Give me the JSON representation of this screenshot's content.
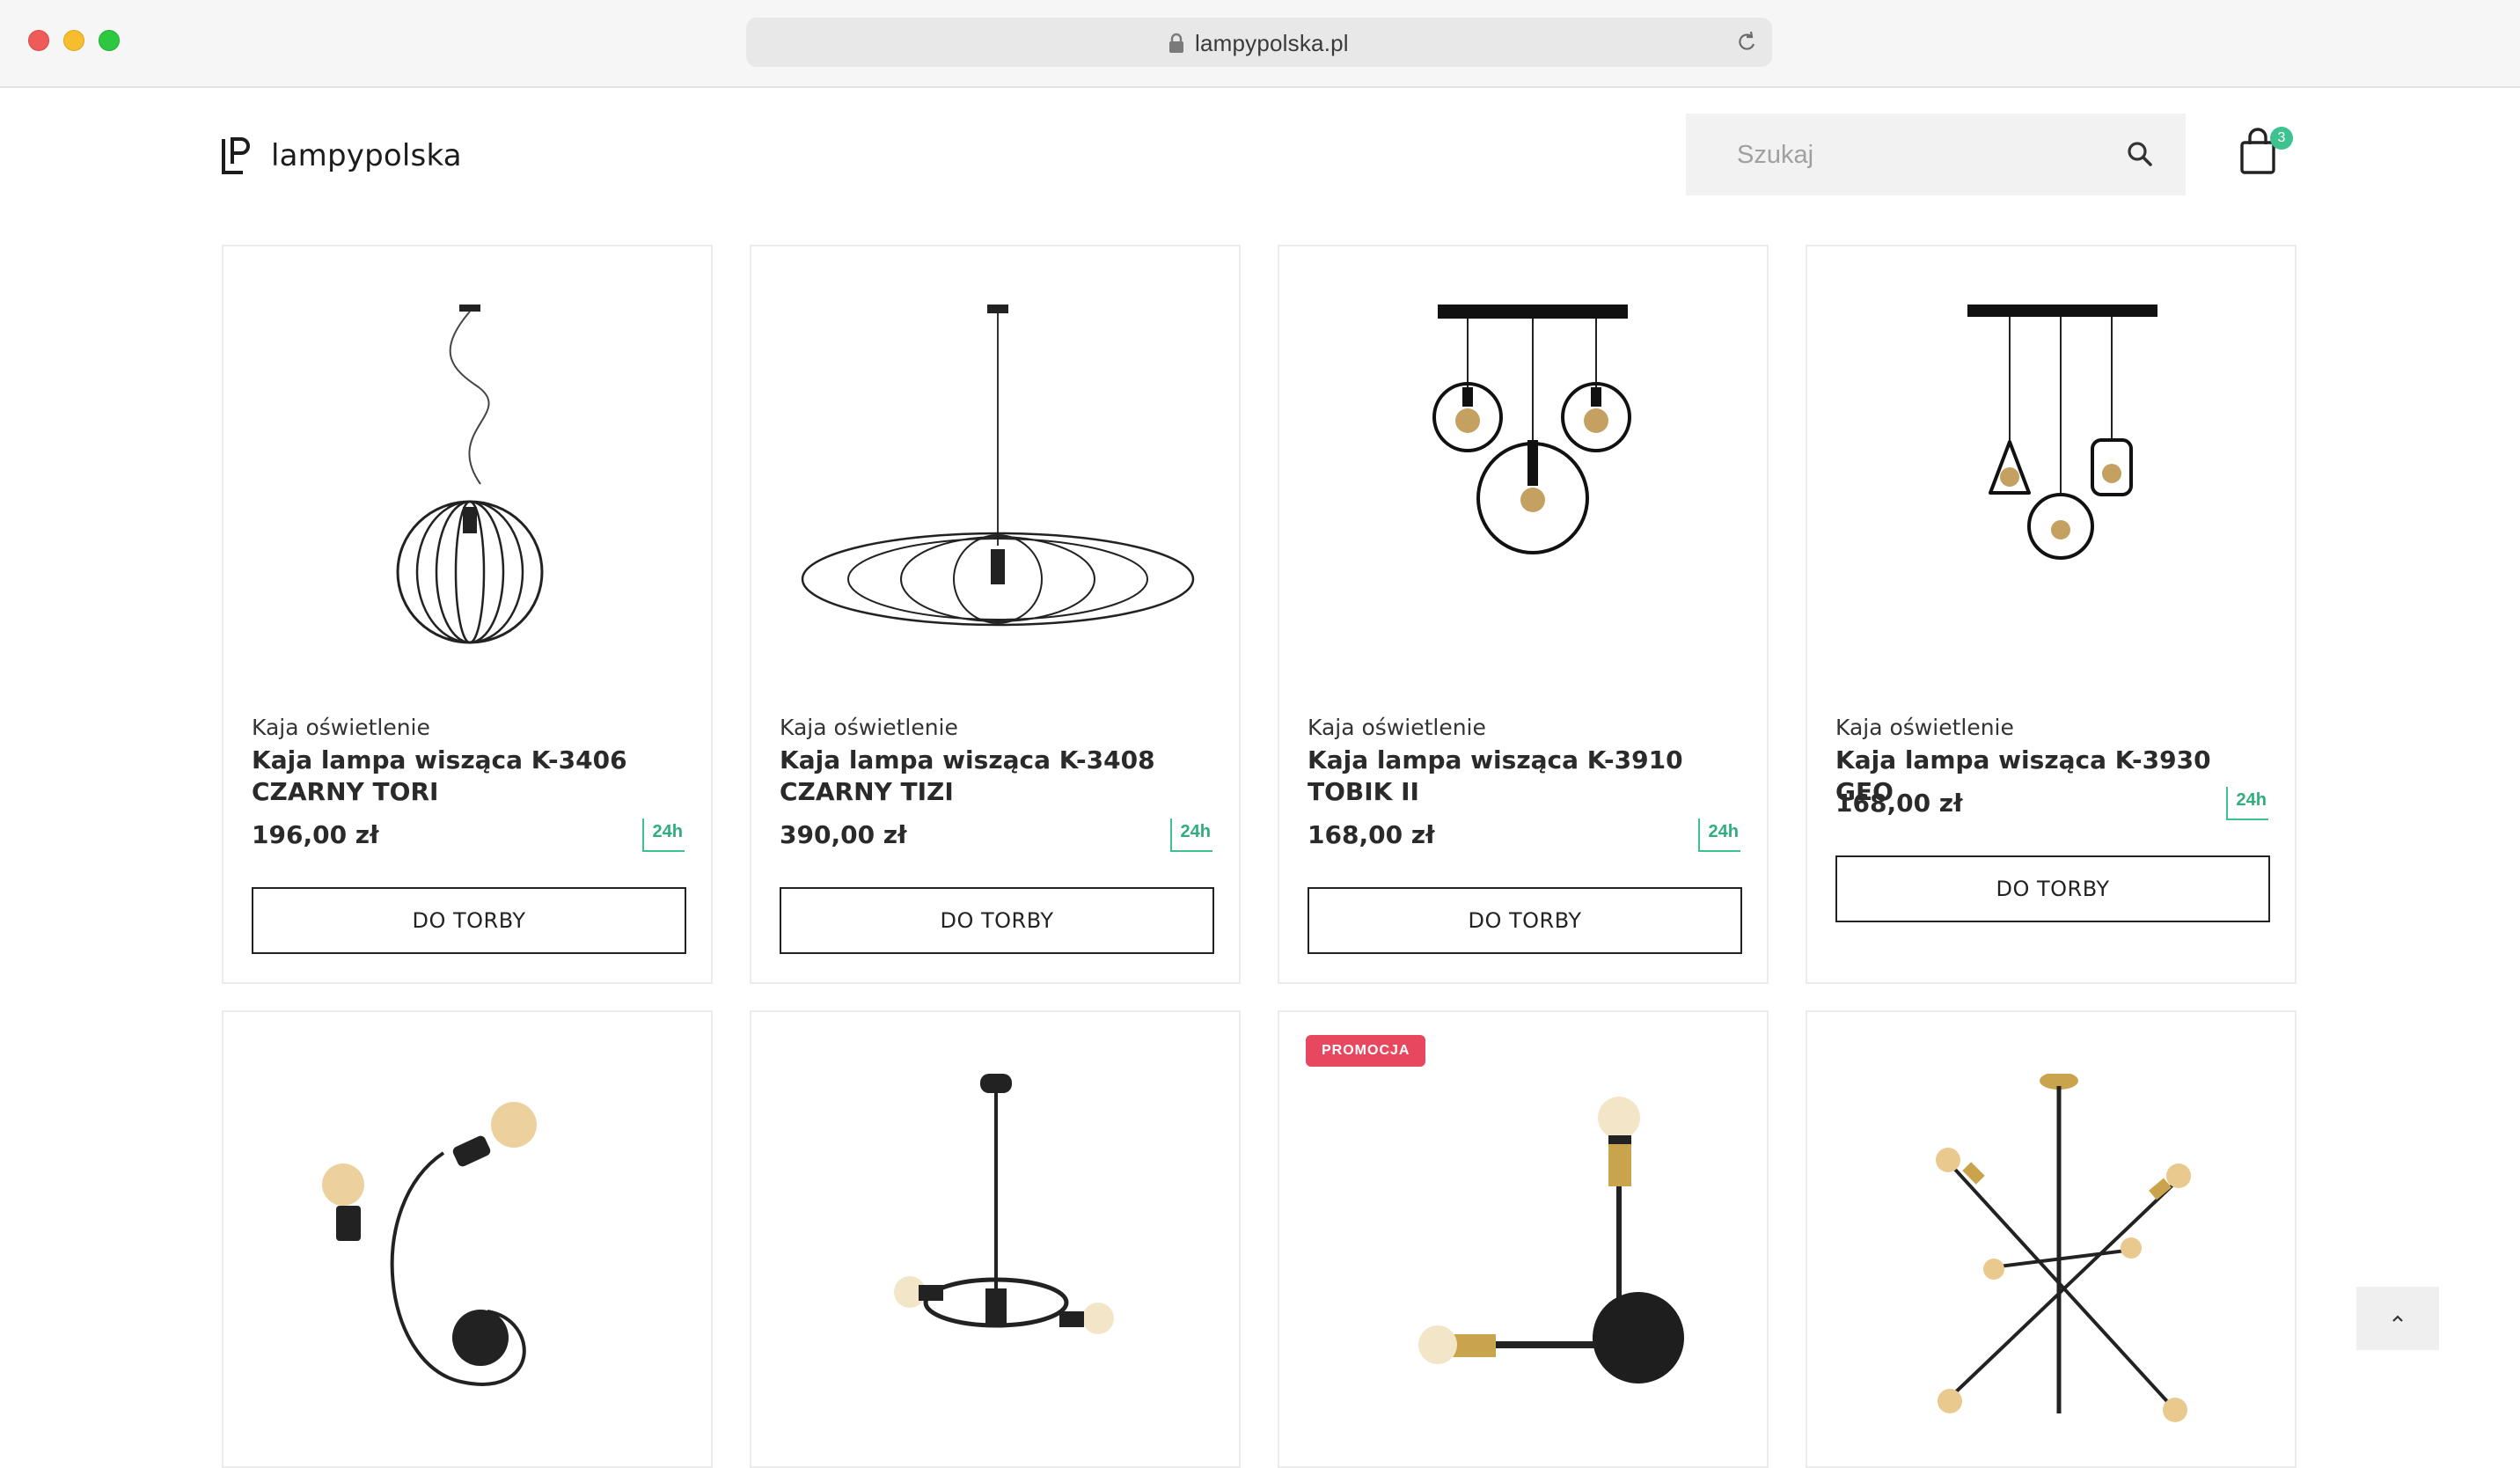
{
  "browser": {
    "url": "lampypolska.pl"
  },
  "header": {
    "logo_text": "lampypolska",
    "search_placeholder": "Szukaj",
    "cart_count": "3"
  },
  "products": [
    {
      "brand": "Kaja oświetlenie",
      "name": "Kaja lampa wisząca K-3406 CZARNY TORI",
      "price": "196,00 zł",
      "delivery": "24h",
      "button": "DO TORBY"
    },
    {
      "brand": "Kaja oświetlenie",
      "name": "Kaja lampa wisząca K-3408 CZARNY TIZI",
      "price": "390,00 zł",
      "delivery": "24h",
      "button": "DO TORBY"
    },
    {
      "brand": "Kaja oświetlenie",
      "name": "Kaja lampa wisząca K-3910 TOBIK II",
      "price": "168,00 zł",
      "delivery": "24h",
      "button": "DO TORBY"
    },
    {
      "brand": "Kaja oświetlenie",
      "name": "Kaja lampa wisząca K-3930 GEO",
      "price": "168,00 zł",
      "delivery": "24h",
      "button": "DO TORBY"
    },
    {
      "promo": ""
    },
    {
      "promo": ""
    },
    {
      "promo": "PROMOCJA"
    },
    {
      "promo": ""
    }
  ],
  "colors": {
    "accent_green": "#3ec28f",
    "promo_red": "#e8485f"
  }
}
